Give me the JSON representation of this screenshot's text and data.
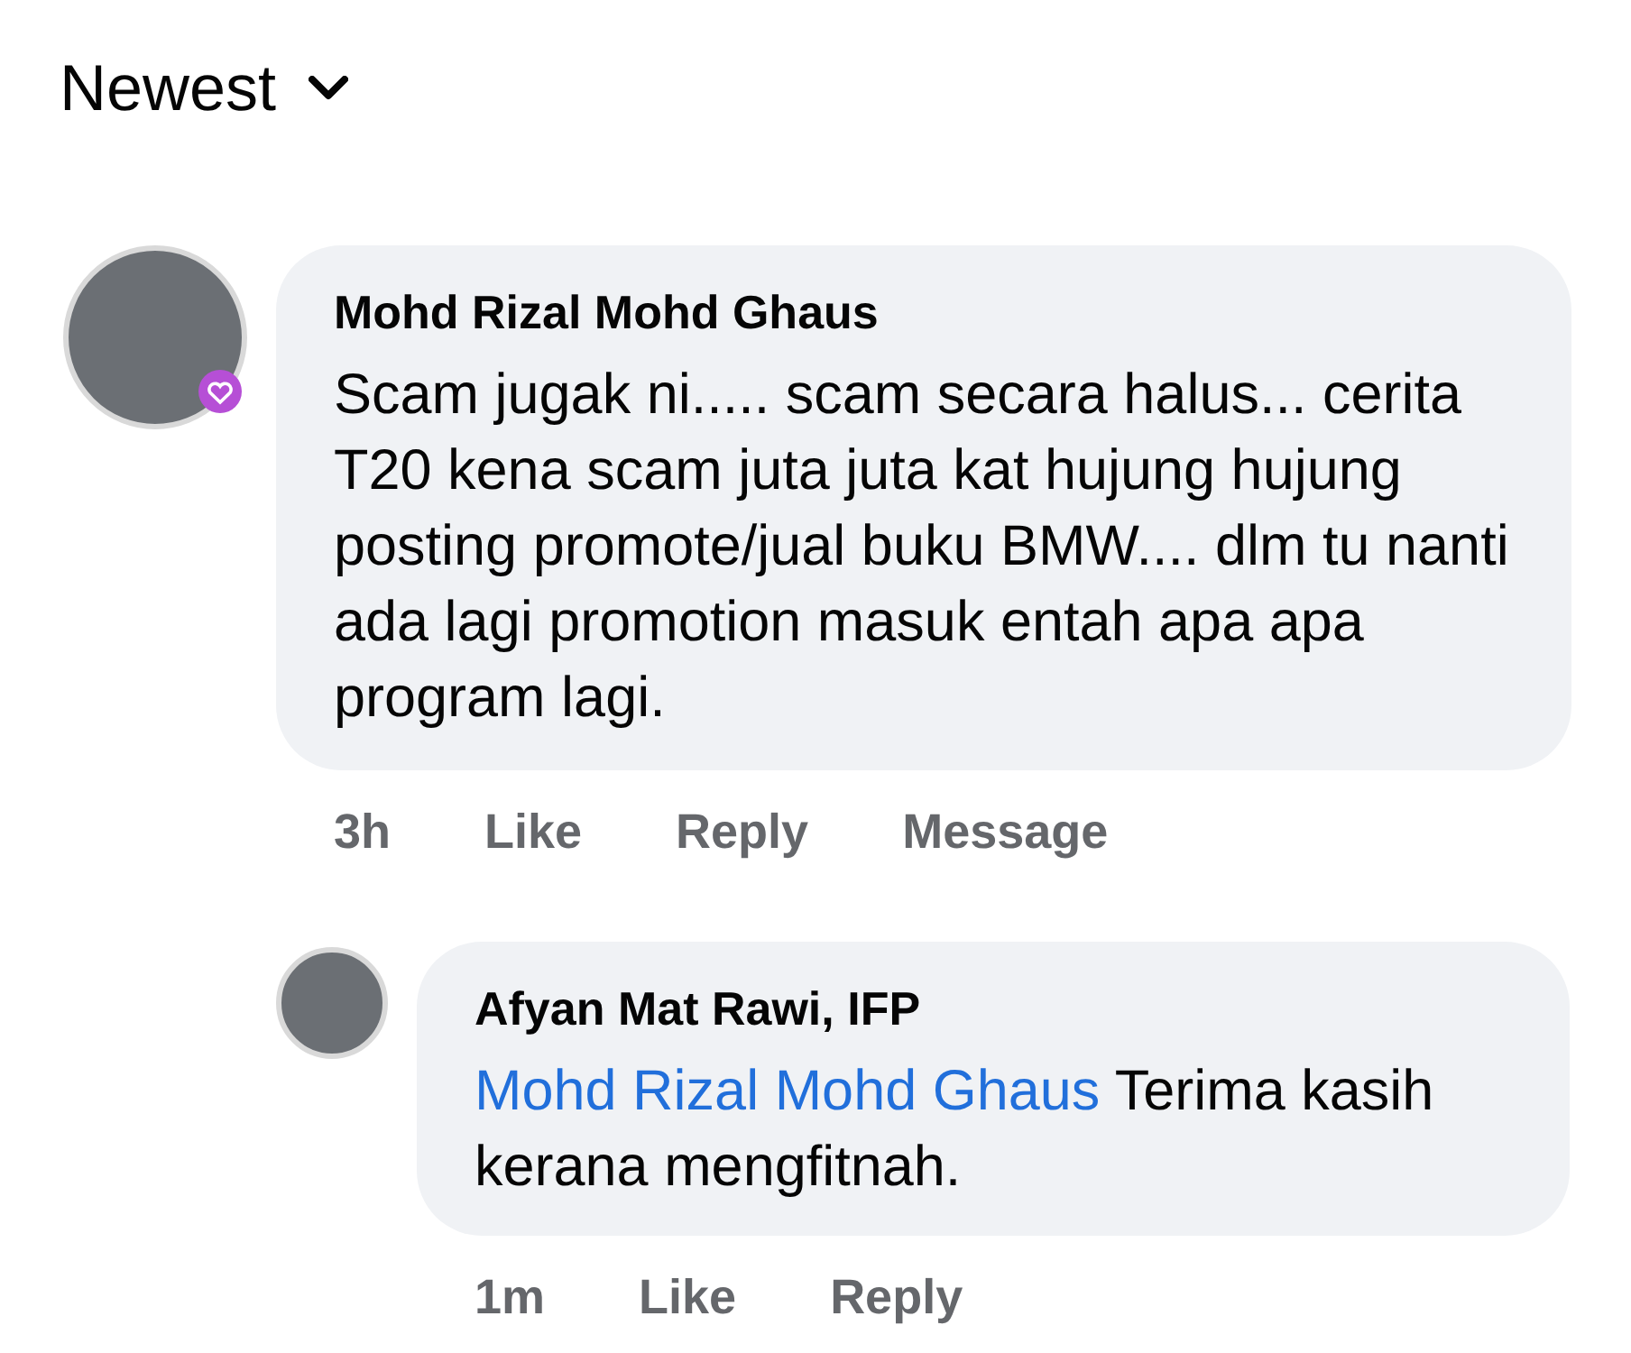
{
  "sort": {
    "label": "Newest"
  },
  "comments": [
    {
      "author": "Mohd Rizal Mohd Ghaus",
      "badge": true,
      "text": "Scam jugak ni..... scam secara halus... cerita T20 kena scam juta juta kat hujung hujung posting promote/jual buku BMW.... dlm tu nanti ada lagi promotion masuk entah apa apa program lagi.",
      "time": "3h",
      "actions": [
        "Like",
        "Reply",
        "Message"
      ],
      "replies": [
        {
          "author": "Afyan Mat Rawi, IFP",
          "badge": false,
          "mention": "Mohd Rizal Mohd Ghaus",
          "text": "Terima kasih kerana mengfitnah.",
          "time": "1m",
          "actions": [
            "Like",
            "Reply"
          ]
        }
      ]
    }
  ]
}
